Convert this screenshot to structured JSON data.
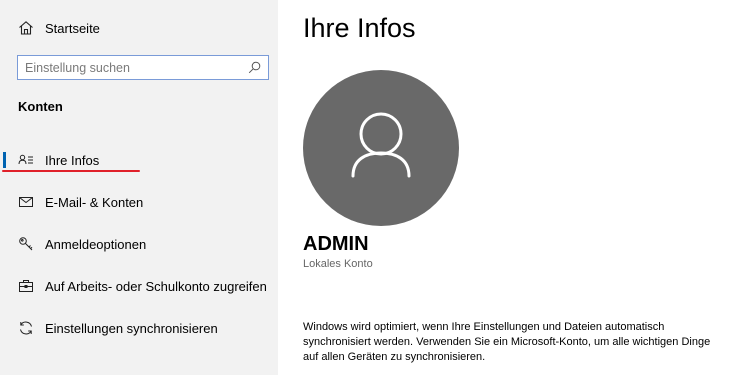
{
  "sidebar": {
    "home_label": "Startseite",
    "search_placeholder": "Einstellung suchen",
    "section_title": "Konten",
    "items": [
      {
        "label": "Ihre Infos",
        "icon": "contact-info-icon",
        "selected": true
      },
      {
        "label": "E-Mail- & Konten",
        "icon": "mail-icon",
        "selected": false
      },
      {
        "label": "Anmeldeoptionen",
        "icon": "key-icon",
        "selected": false
      },
      {
        "label": "Auf Arbeits- oder Schulkonto zugreifen",
        "icon": "briefcase-icon",
        "selected": false
      },
      {
        "label": "Einstellungen synchronisieren",
        "icon": "sync-icon",
        "selected": false
      }
    ]
  },
  "main": {
    "title": "Ihre Infos",
    "user_name": "ADMIN",
    "account_type": "Lokales Konto",
    "info_text": "Windows wird optimiert, wenn Ihre Einstellungen und Dateien automatisch synchronisiert werden. Verwenden Sie ein Microsoft-Konto, um alle wichtigen Dinge auf allen Geräten zu synchronisieren."
  },
  "colors": {
    "accent": "#0063b1",
    "highlight_underline": "#e0202a",
    "avatar_bg": "#696969"
  }
}
